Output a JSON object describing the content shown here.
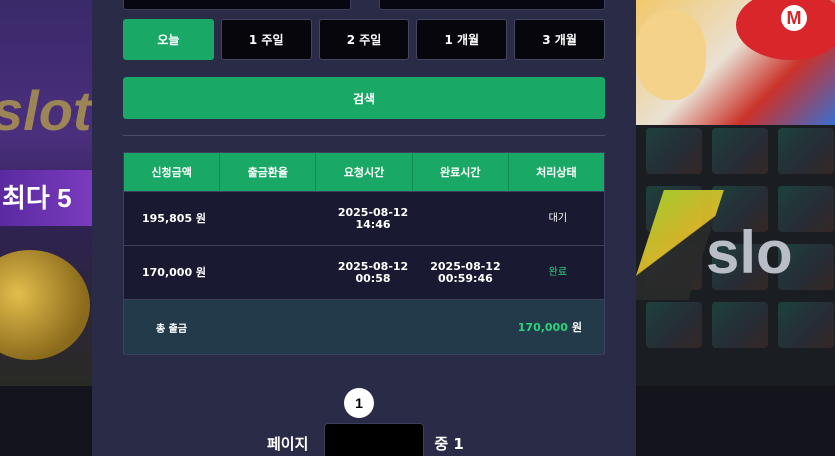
{
  "background": {
    "left_brand_text": "slot",
    "left_bonus_text": "최다 5",
    "right_brand_text": "slo",
    "right_cap_letter": "M"
  },
  "range_buttons": [
    {
      "label": "오늘",
      "active": true
    },
    {
      "label": "1 주일",
      "active": false
    },
    {
      "label": "2 주일",
      "active": false
    },
    {
      "label": "1 개월",
      "active": false
    },
    {
      "label": "3 개월",
      "active": false
    }
  ],
  "search_label": "검색",
  "table": {
    "headers": [
      "신청금액",
      "출금환율",
      "요청시간",
      "완료시간",
      "처리상태"
    ],
    "rows": [
      {
        "amount": "195,805 원",
        "rate": "",
        "request_date": "2025-08-12",
        "request_time": "14:46",
        "complete_date": "",
        "complete_time": "",
        "status": "대기"
      },
      {
        "amount": "170,000 원",
        "rate": "",
        "request_date": "2025-08-12",
        "request_time": "00:58",
        "complete_date": "2025-08-12",
        "complete_time": "00:59:46",
        "status": "완료"
      }
    ],
    "total_label": "총 출금",
    "total_value": "170,000",
    "total_unit": "원"
  },
  "pagination": {
    "current_page": "1",
    "page_label": "페이지",
    "page_input_value": "",
    "of_label": "중 1"
  },
  "colors": {
    "accent": "#1aa866",
    "panel": "#2a2b46",
    "status_done": "#2fd27a"
  }
}
